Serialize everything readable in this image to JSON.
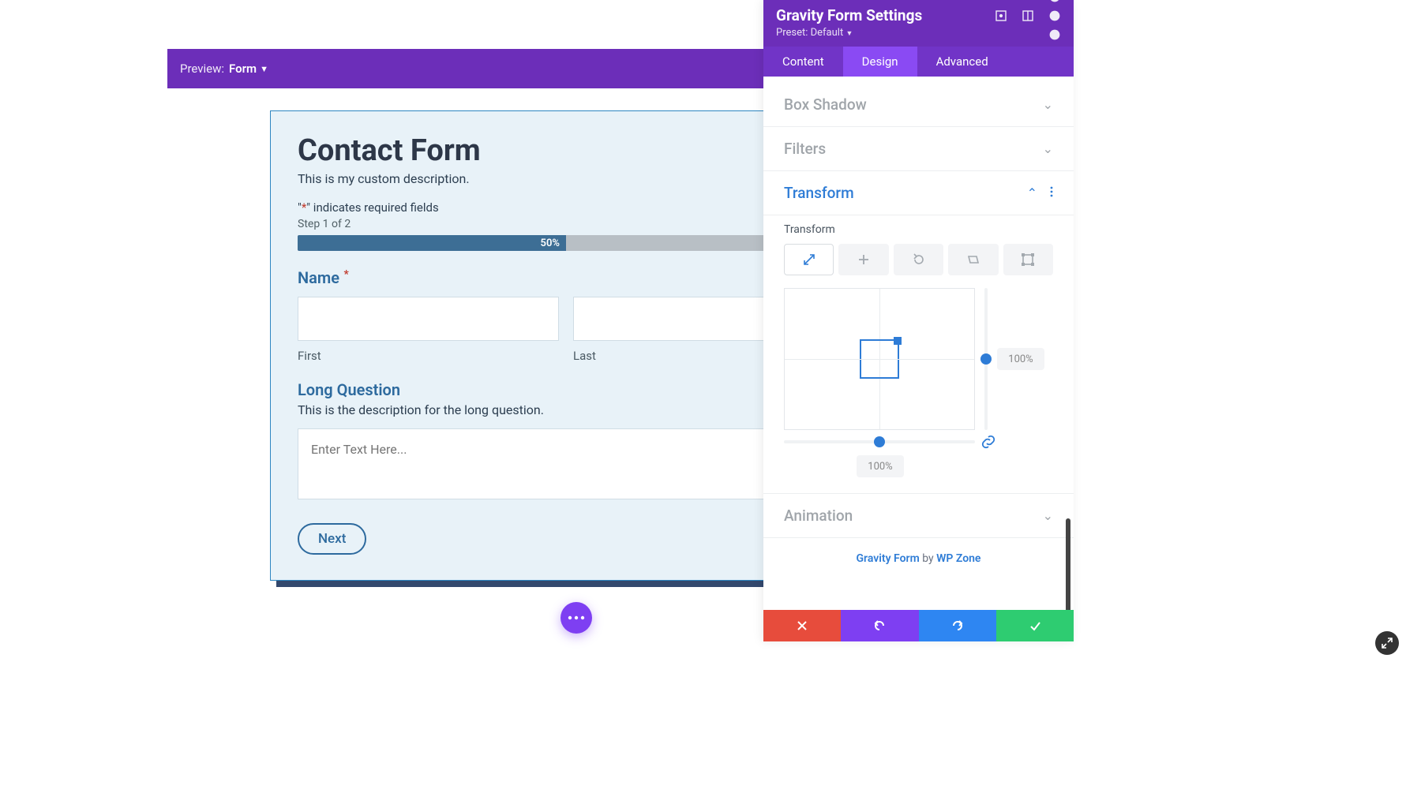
{
  "preview": {
    "label": "Preview:",
    "value": "Form"
  },
  "form": {
    "title": "Contact Form",
    "description": "This is my custom description.",
    "required_msg_prefix": "\"",
    "required_star": "*",
    "required_msg_suffix": "\" indicates required fields",
    "step": "Step 1 of 2",
    "progress_text": "50%",
    "name_label": "Name",
    "first_label": "First",
    "last_label": "Last",
    "lq_label": "Long Question",
    "lq_desc": "This is the description for the long question.",
    "lq_placeholder": "Enter Text Here...",
    "next": "Next"
  },
  "panel": {
    "title": "Gravity Form Settings",
    "preset": "Preset: Default",
    "tabs": {
      "content": "Content",
      "design": "Design",
      "advanced": "Advanced"
    },
    "sections": {
      "box_shadow": "Box Shadow",
      "filters": "Filters",
      "transform": "Transform",
      "animation": "Animation"
    },
    "transform_label": "Transform",
    "y_value": "100%",
    "x_value": "100%"
  },
  "credit": {
    "product": "Gravity Form",
    "by": " by ",
    "vendor": "WP Zone"
  }
}
